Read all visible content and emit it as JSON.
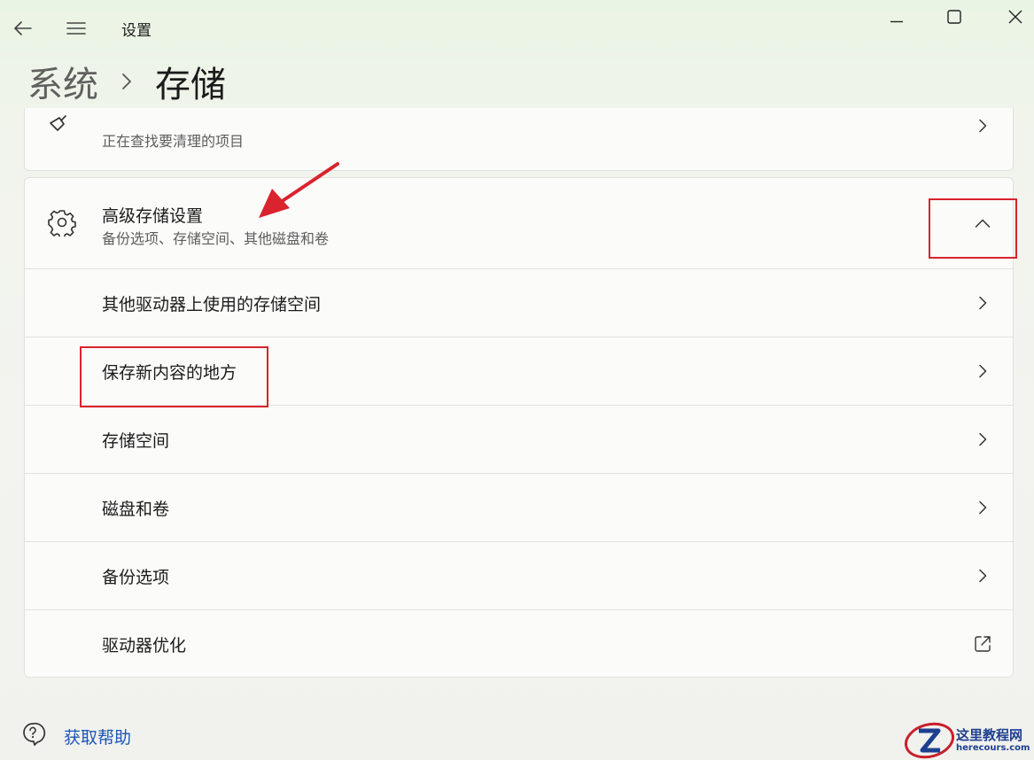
{
  "window": {
    "title": "设置",
    "back_icon": "back-arrow-icon",
    "menu_icon": "hamburger-menu-icon",
    "controls": [
      "minimize-icon",
      "maximize-icon",
      "close-icon"
    ]
  },
  "breadcrumb": {
    "parent": "系统",
    "separator_icon": "chevron-right-icon",
    "current": "存储"
  },
  "cleanup_card": {
    "icon": "broom-icon",
    "subtitle": "正在查找要清理的项目"
  },
  "advanced": {
    "icon": "gear-icon",
    "title": "高级存储设置",
    "subtitle": "备份选项、存储空间、其他磁盘和卷",
    "expanded": true,
    "items": [
      {
        "label": "其他驱动器上使用的存储空间",
        "action_icon": "chevron-right-icon"
      },
      {
        "label": "保存新内容的地方",
        "action_icon": "chevron-right-icon"
      },
      {
        "label": "存储空间",
        "action_icon": "chevron-right-icon"
      },
      {
        "label": "磁盘和卷",
        "action_icon": "chevron-right-icon"
      },
      {
        "label": "备份选项",
        "action_icon": "chevron-right-icon"
      },
      {
        "label": "驱动器优化",
        "action_icon": "open-external-icon"
      }
    ]
  },
  "help": {
    "icon": "help-chat-icon",
    "label": "获取帮助"
  },
  "watermark": {
    "title": "这里教程网",
    "url": "herecours.com"
  },
  "colors": {
    "annotation_red": "#d9232d",
    "link_blue": "#1a56b5"
  }
}
